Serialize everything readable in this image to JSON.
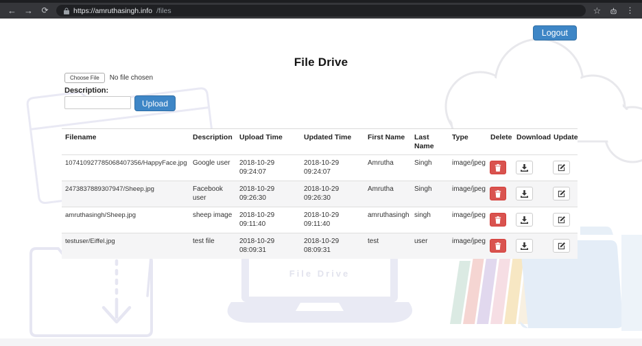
{
  "browser": {
    "url_host": "https://amruthasingh.info",
    "url_path": "/files",
    "icons": [
      "back-arrow-icon",
      "forward-arrow-icon",
      "refresh-icon",
      "lock-icon",
      "bookmark-star-icon",
      "extensions-icon",
      "menu-dots-icon"
    ]
  },
  "header": {
    "title": "File Drive",
    "logout_label": "Logout"
  },
  "upload": {
    "choose_file_label": "Choose File",
    "no_file_text": "No file chosen",
    "description_label": "Description:",
    "description_value": "",
    "upload_label": "Upload"
  },
  "table": {
    "columns": [
      "Filename",
      "Description",
      "Upload Time",
      "Updated Time",
      "First Name",
      "Last Name",
      "Type",
      "Delete",
      "Download",
      "Update"
    ],
    "rows": [
      {
        "filename": "107410927785068407356/HappyFace.jpg",
        "description": "Google user",
        "upload_time": "2018-10-29 09:24:07",
        "updated_time": "2018-10-29 09:24:07",
        "first_name": "Amrutha",
        "last_name": "Singh",
        "type": "image/jpeg"
      },
      {
        "filename": "2473837889307947/Sheep.jpg",
        "description": "Facebook user",
        "upload_time": "2018-10-29 09:26:30",
        "updated_time": "2018-10-29 09:26:30",
        "first_name": "Amrutha",
        "last_name": "Singh",
        "type": "image/jpeg"
      },
      {
        "filename": "amruthasingh/Sheep.jpg",
        "description": "sheep image",
        "upload_time": "2018-10-29 09:11:40",
        "updated_time": "2018-10-29 09:11:40",
        "first_name": "amruthasingh",
        "last_name": "singh",
        "type": "image/jpeg"
      },
      {
        "filename": "testuser/Eiffel.jpg",
        "description": "test file",
        "upload_time": "2018-10-29 08:09:31",
        "updated_time": "2018-10-29 08:09:31",
        "first_name": "test",
        "last_name": "user",
        "type": "image/jpeg"
      }
    ],
    "actions": [
      {
        "name": "delete-button",
        "icon": "trash-icon"
      },
      {
        "name": "download-button",
        "icon": "download-icon"
      },
      {
        "name": "update-button",
        "icon": "edit-icon"
      }
    ]
  },
  "watermark": {
    "laptop_text": "File Drive"
  },
  "colors": {
    "button_primary": "#3e86c6",
    "button_danger": "#d9534f",
    "chrome_toolbar": "#35363a",
    "chrome_omnibox": "#1f2023"
  }
}
